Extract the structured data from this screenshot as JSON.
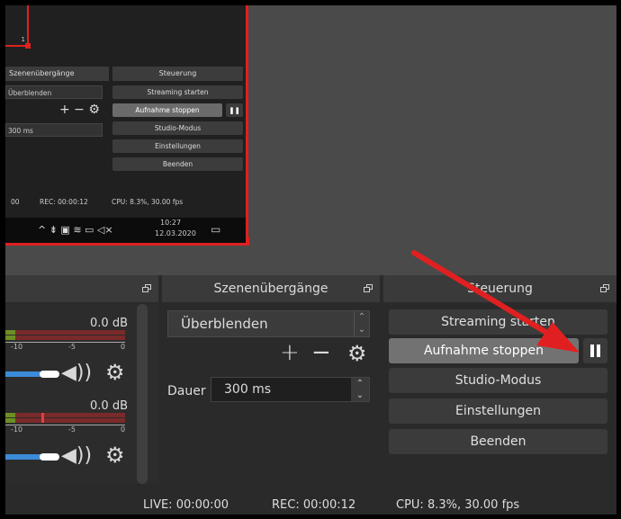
{
  "preview": {
    "mini": {
      "top_box_text": "1",
      "scene_transitions_header": "Szenenübergänge",
      "controls_header": "Steuerung",
      "transition_value": "Überblenden",
      "duration_value": "300 ms",
      "start_streaming": "Streaming starten",
      "stop_recording": "Aufnahme stoppen",
      "studio_mode": "Studio-Modus",
      "settings": "Einstellungen",
      "exit": "Beenden",
      "status_live": "00",
      "status_rec": "REC: 00:00:12",
      "status_cpu": "CPU: 8.3%, 30.00 fps",
      "clock_time": "10:27",
      "clock_date": "12.03.2020"
    }
  },
  "mixer": {
    "channels": [
      {
        "level": "0.0 dB",
        "tick_labels": [
          "-10",
          "-5",
          "0"
        ]
      },
      {
        "level": "0.0 dB",
        "tick_labels": [
          "-10",
          "-5",
          "0"
        ]
      }
    ]
  },
  "transitions": {
    "header": "Szenenübergänge",
    "selected": "Überblenden",
    "duration_label": "Dauer",
    "duration_value": "300 ms"
  },
  "controls": {
    "header": "Steuerung",
    "start_streaming": "Streaming starten",
    "stop_recording": "Aufnahme stoppen",
    "studio_mode": "Studio-Modus",
    "settings": "Einstellungen",
    "exit": "Beenden"
  },
  "statusbar": {
    "live": "LIVE: 00:00:00",
    "rec": "REC: 00:00:12",
    "cpu": "CPU: 8.3%, 30.00 fps"
  },
  "colors": {
    "highlight_red": "#e02020",
    "panel_bg": "#2a2a2a",
    "button_bg": "#3b3b3b",
    "active_button_bg": "#727272",
    "slider_blue": "#3b8bd8"
  }
}
